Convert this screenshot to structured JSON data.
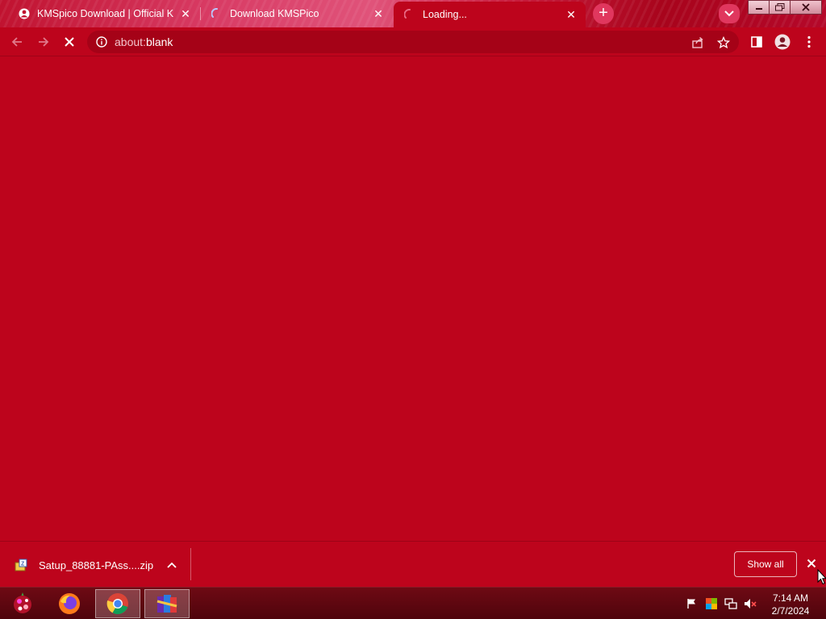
{
  "browser": {
    "tabs": [
      {
        "title": "KMSpico Download | Official KM",
        "favicon": "site-icon",
        "state": "loaded"
      },
      {
        "title": "Download KMSPico",
        "favicon": "loading-spinner-icon",
        "state": "loading"
      },
      {
        "title": "Loading...",
        "favicon": "loading-spinner-icon",
        "state": "loading",
        "active": true
      }
    ],
    "new_tab_label": "+",
    "address_bar": {
      "prefix": "about:",
      "text": "blank"
    }
  },
  "download_shelf": {
    "file_name": "Satup_88881-PAss....zip",
    "show_all_label": "Show all"
  },
  "taskbar": {
    "apps": [
      "start-orb-icon",
      "firefox-icon",
      "chrome-icon",
      "winrar-icon"
    ],
    "clock": {
      "time": "7:14 AM",
      "date": "2/7/2024"
    }
  },
  "colors": {
    "accent": "#bd041c",
    "tabstrip": "#d83a63",
    "taskbar": "#5e0710"
  }
}
